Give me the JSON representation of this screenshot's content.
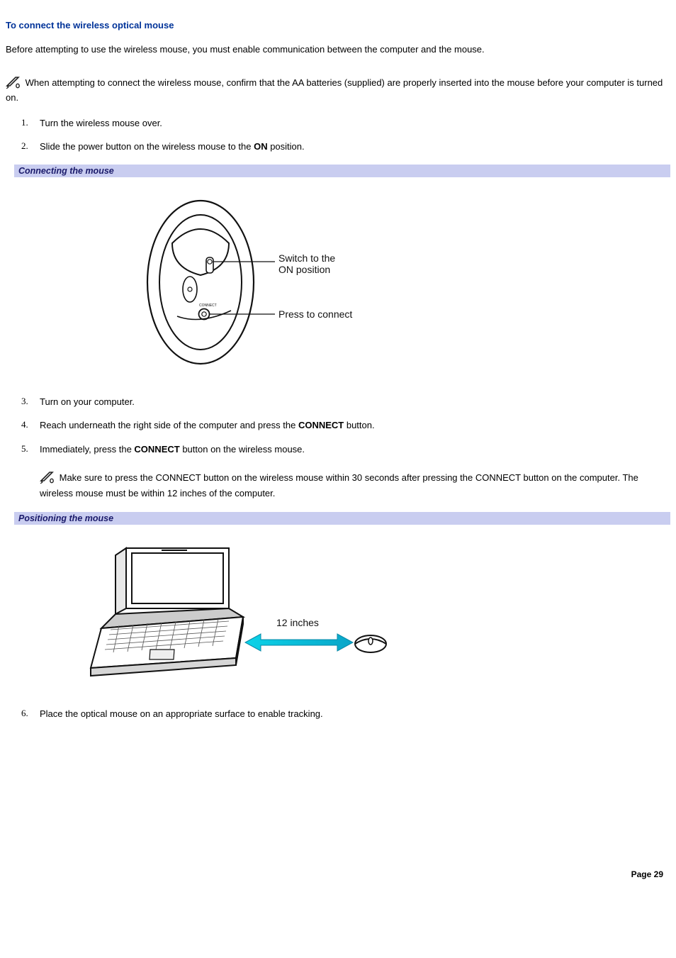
{
  "title": "To connect the wireless optical mouse",
  "intro": "Before attempting to use the wireless mouse, you must enable communication between the computer and the mouse.",
  "note1": "When attempting to connect the wireless mouse, confirm that the AA batteries (supplied) are properly inserted into the mouse before your computer is turned on.",
  "steps": {
    "s1": "Turn the wireless mouse over.",
    "s2_a": "Slide the power button on the wireless mouse to the ",
    "s2_b": "ON",
    "s2_c": " position.",
    "s3": "Turn on your computer.",
    "s4_a": "Reach underneath the right side of the computer and press the ",
    "s4_b": "CONNECT",
    "s4_c": " button.",
    "s5_a": "Immediately, press the ",
    "s5_b": "CONNECT",
    "s5_c": " button on the wireless mouse.",
    "s6": "Place the optical mouse on an appropriate surface to enable tracking."
  },
  "markers": {
    "m1": "1.",
    "m2": "2.",
    "m3": "3.",
    "m4": "4.",
    "m5": "5.",
    "m6": "6."
  },
  "subhead1": "Connecting the mouse",
  "subhead2": "Positioning the mouse",
  "note2": "Make sure to press the CONNECT button on the wireless mouse within 30 seconds after pressing the CONNECT button on the computer. The wireless mouse must be within 12 inches of the computer.",
  "fig1": {
    "label_switch_l1": "Switch to the",
    "label_switch_l2": "ON position",
    "label_press": "Press to connect"
  },
  "fig2": {
    "label_distance": "12 inches"
  },
  "footer": "Page 29"
}
